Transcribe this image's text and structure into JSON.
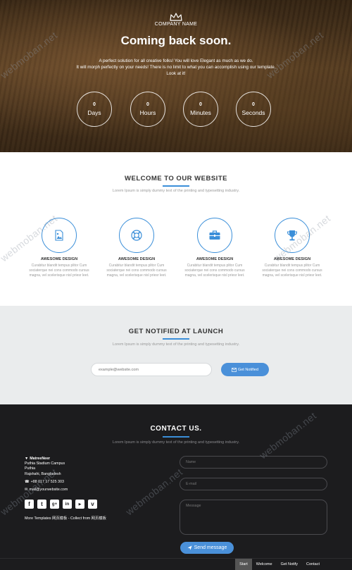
{
  "hero": {
    "company": "COMPANY NAME",
    "title": "Coming back soon.",
    "text_line1": "A perfect solution for all creative folks! You will love Elegant as much as we do.",
    "text_line2": "It will morph perfectly on your needs! There is no limit to what you can accomplish using our template.",
    "text_line3": "Look at it!",
    "counters": [
      {
        "value": "0",
        "label": "Days"
      },
      {
        "value": "0",
        "label": "Hours"
      },
      {
        "value": "0",
        "label": "Minutes"
      },
      {
        "value": "0",
        "label": "Seconds"
      }
    ]
  },
  "welcome": {
    "title": "WELCOME TO OUR WEBSITE",
    "subtitle": "Lorem Ipsum is simply dummy text of the printing and typesetting industry.",
    "features": [
      {
        "icon": "image-document-icon",
        "title": "AWESOME DESIGN",
        "text": "Curabitur blandit tempus plitor Cum sociaterque nei cons commodo cursus magna, vel scelerisque nisl priesr leet."
      },
      {
        "icon": "lifebuoy-icon",
        "title": "AWESOME DESIGN",
        "text": "Curabitur blandit tempus plitor Cum sociaterque nei cons commodo cursus magna, vel scelerisque nisl priesr leet."
      },
      {
        "icon": "briefcase-icon",
        "title": "AWESOME DESIGN",
        "text": "Curabitur blandit tempus plitor Cum sociaterque nei cons commodo cursus magna, vel scelerisque nisl priesr leet."
      },
      {
        "icon": "trophy-icon",
        "title": "AWESOME DESIGN",
        "text": "Curabitur blandit tempus plitor Cum sociaterque nei cons commodo cursus magna, vel scelerisque nisl priesr leet."
      }
    ]
  },
  "notify": {
    "title": "GET NOTIFIED AT LAUNCH",
    "subtitle": "Lorem Ipsum is simply dummy text of the printing and typesetting industry.",
    "email_placeholder": "example@website.com",
    "button_label": "Get Notified"
  },
  "contact": {
    "title": "CONTACT US.",
    "subtitle": "Lorem Ipsum is simply dummy text of the printing and typesetting industry.",
    "address_name": "MatreeNeer",
    "address_line2": "Puthia Stadium Campus",
    "address_line3": "Puthia",
    "address_line4": "Rajshahi, Bangladesh",
    "phone": "+88 017 17 525 303",
    "email": "mail@yourwebsite.com",
    "socials": [
      "facebook-icon",
      "twitter-icon",
      "google-plus-icon",
      "linkedin-icon",
      "youtube-icon",
      "vimeo-icon"
    ],
    "more_templates": "More Templates 网页模板 - Collect from 网页模板",
    "name_placeholder": "Name",
    "email_field_placeholder": "E-mail",
    "message_placeholder": "Message",
    "send_label": "Send message"
  },
  "bottom_nav": {
    "items": [
      "Start",
      "Welcome",
      "Get Notify",
      "Contact"
    ]
  },
  "watermark": "webmoban.net",
  "colors": {
    "accent": "#3b8fd9",
    "button_blue": "#4a90d9",
    "footer_bg": "#1c1c1e",
    "notify_bg": "#eaeced"
  }
}
